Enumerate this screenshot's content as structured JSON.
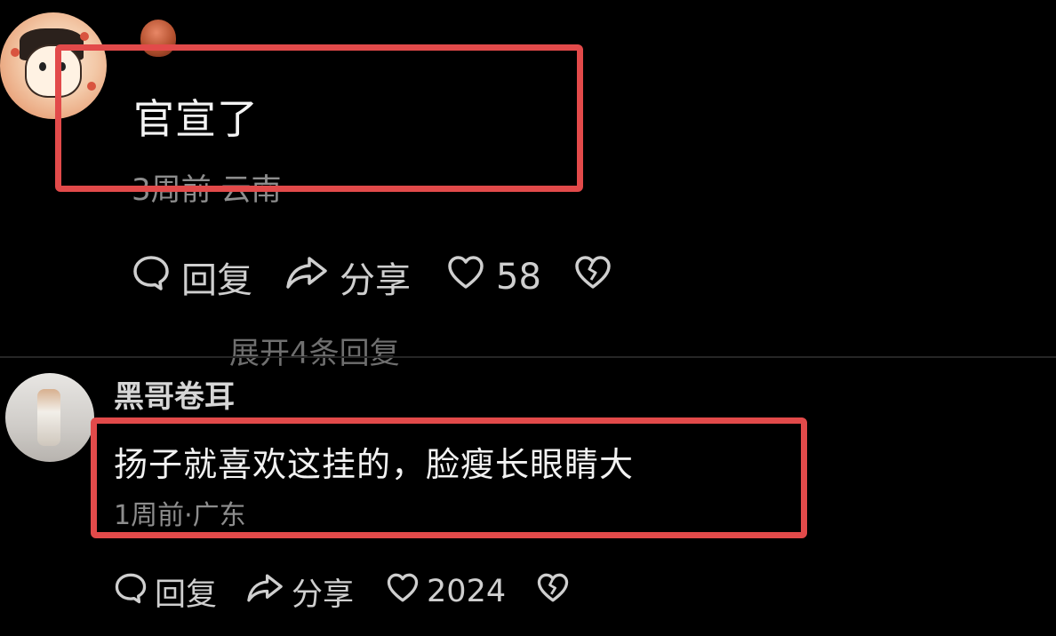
{
  "comments": [
    {
      "author": "",
      "text": "官宣了",
      "meta": "3周前·云南",
      "reply_label": "回复",
      "share_label": "分享",
      "likes": "58",
      "more_replies": "展开4条回复",
      "avatar_icon": "cartoon-avatar-icon",
      "highlight_color": "#e24a4a"
    },
    {
      "author": "黑哥卷耳",
      "text": "扬子就喜欢这挂的，脸瘦长眼睛大",
      "meta": "1周前·广东",
      "reply_label": "回复",
      "share_label": "分享",
      "likes": "2024",
      "avatar_icon": "figure-avatar-icon",
      "highlight_color": "#e24a4a"
    }
  ],
  "icons": {
    "reply": "comment-bubble-icon",
    "share": "share-arrow-icon",
    "like": "heart-icon",
    "dislike": "broken-heart-icon"
  }
}
